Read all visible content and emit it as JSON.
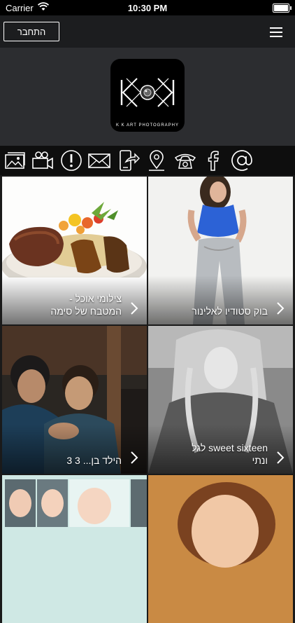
{
  "status_bar": {
    "carrier": "Carrier",
    "time": "10:30 PM",
    "wifi_icon": "wifi-icon",
    "battery_icon": "battery-icon"
  },
  "navbar": {
    "login_label": "התחבר",
    "menu_icon": "hamburger-icon"
  },
  "header": {
    "logo_text": "K K ART PHOTOGRAPHY"
  },
  "toolbar": {
    "icons": [
      "gallery-icon",
      "video-icon",
      "info-icon",
      "mail-icon",
      "share-icon",
      "location-icon",
      "phone-icon",
      "facebook-icon",
      "at-icon"
    ]
  },
  "gallery": {
    "tiles": [
      {
        "caption_line1": "צילומי אוכל -",
        "caption_line2": "המטבח של סימה"
      },
      {
        "caption_line1": "בוק סטודיו לאלינור",
        "caption_line2": ""
      },
      {
        "caption_line1": "הילד בן... 3 3",
        "caption_line2": ""
      },
      {
        "caption_line1": "sweet sixteen לגל",
        "caption_line2": "ונתי"
      },
      {
        "caption_line1": "",
        "caption_line2": ""
      },
      {
        "caption_line1": "",
        "caption_line2": ""
      }
    ]
  },
  "colors": {
    "navbar_bg": "#1c1d1f",
    "header_bg": "#2c2d30",
    "toolbar_bg": "#0e0e0e"
  }
}
